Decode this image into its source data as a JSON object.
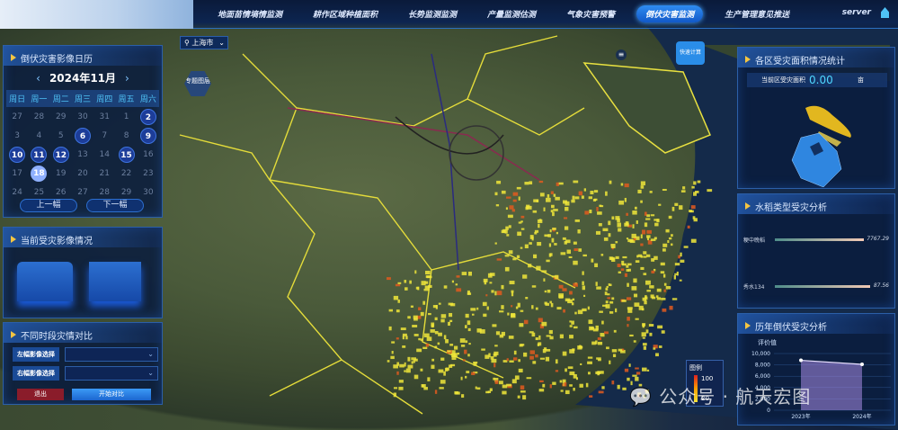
{
  "header": {
    "nav": [
      "地面苗情墒情监测",
      "耕作区域种植面积",
      "长势监测监测",
      "产量监测估测",
      "气象灾害预警",
      "倒伏灾害监测",
      "生产管理意见推送"
    ],
    "active_index": 5,
    "user": "server"
  },
  "map": {
    "city": "上海市",
    "layer_button": "专题图层",
    "quick_calc": "快速计算",
    "legend_title": "图例",
    "legend_max": "100",
    "legend_min": "20"
  },
  "calendar": {
    "title": "倒伏灾害影像日历",
    "month": "2024年11月",
    "weekdays": [
      "周日",
      "周一",
      "周二",
      "周三",
      "周四",
      "周五",
      "周六"
    ],
    "days": [
      {
        "d": "27",
        "o": 1
      },
      {
        "d": "28",
        "o": 1
      },
      {
        "d": "29",
        "o": 1
      },
      {
        "d": "30",
        "o": 1
      },
      {
        "d": "31",
        "o": 1
      },
      {
        "d": "1"
      },
      {
        "d": "2",
        "m": 1
      },
      {
        "d": "3"
      },
      {
        "d": "4"
      },
      {
        "d": "5"
      },
      {
        "d": "6",
        "m": 1
      },
      {
        "d": "7"
      },
      {
        "d": "8"
      },
      {
        "d": "9",
        "m": 1
      },
      {
        "d": "10",
        "m": 1
      },
      {
        "d": "11",
        "m": 1
      },
      {
        "d": "12",
        "m": 1
      },
      {
        "d": "13"
      },
      {
        "d": "14"
      },
      {
        "d": "15",
        "m": 1
      },
      {
        "d": "16"
      },
      {
        "d": "17"
      },
      {
        "d": "18",
        "s": 1
      },
      {
        "d": "19"
      },
      {
        "d": "20"
      },
      {
        "d": "21"
      },
      {
        "d": "22"
      },
      {
        "d": "23"
      },
      {
        "d": "24"
      },
      {
        "d": "25"
      },
      {
        "d": "26"
      },
      {
        "d": "27"
      },
      {
        "d": "28"
      },
      {
        "d": "29"
      },
      {
        "d": "30"
      }
    ],
    "prev": "上一幅",
    "next": "下一幅"
  },
  "current": {
    "title": "当前受灾影像情况"
  },
  "compare": {
    "title": "不同时段灾情对比",
    "left_label": "左幅影像选择",
    "right_label": "右幅影像选择",
    "exit": "退出",
    "start": "开始对比"
  },
  "district": {
    "title": "各区受灾面积情况统计",
    "area_label": "当前区受灾面积",
    "area_value": "0.00",
    "unit": "亩"
  },
  "variety": {
    "title": "水稻类型受灾分析",
    "items": [
      {
        "name": "粳中晚稻",
        "value": "7767.29",
        "pct": 0.9
      },
      {
        "name": "秀水134",
        "value": "87.56",
        "pct": 0.96
      }
    ]
  },
  "history": {
    "title": "历年倒伏受灾分析",
    "ylabel": "评价值",
    "chart_data": {
      "type": "area",
      "x": [
        "2023年",
        "2024年"
      ],
      "values": [
        8800,
        8100
      ],
      "yticks": [
        "10,000",
        "8,000",
        "6,000",
        "4,000",
        "2,000",
        "0"
      ],
      "ylim": [
        0,
        10000
      ]
    }
  },
  "watermark": "公众号 · 航天宏图",
  "colors": {
    "accent": "#2f8cf0",
    "boundary": "#f4e23a",
    "flood": "#e05a1e"
  }
}
